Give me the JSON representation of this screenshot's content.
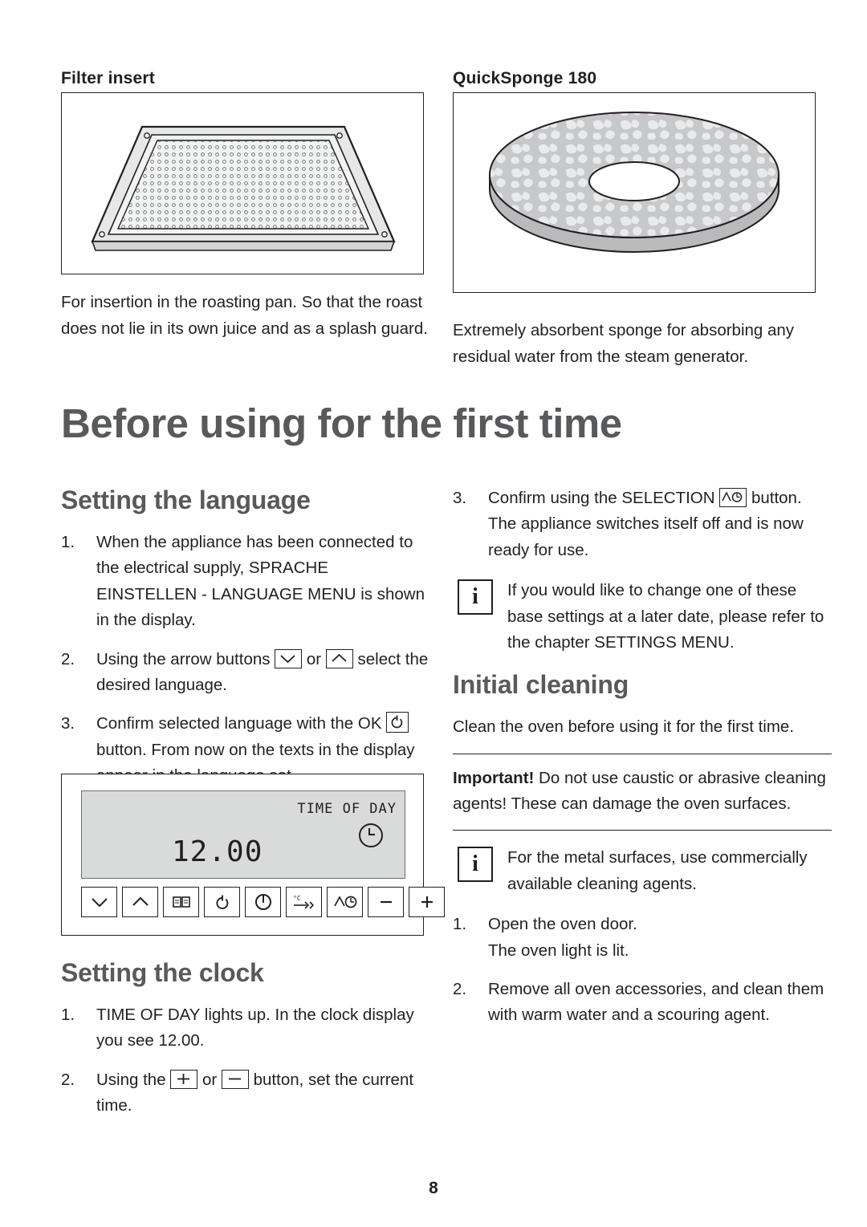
{
  "page": {
    "number": "8"
  },
  "top": {
    "left_heading": "Filter insert",
    "right_heading": "QuickSponge 180",
    "left_caption": "For insertion in the roasting pan. So that the roast does not lie in its own juice and as a splash guard.",
    "right_caption": "Extremely absorbent sponge for absorbing any residual water from the steam generator.",
    "left_figure_name": "filter-insert-illustration",
    "right_figure_name": "quicksponge-illustration"
  },
  "chapter": {
    "title": "Before using for the first time"
  },
  "language": {
    "heading": "Setting the language",
    "steps": [
      {
        "num": "1.",
        "text_a": "When the appliance has been connected to the electrical supply, SPRACHE EINSTELLEN - LANGUAGE MENU is shown in the display."
      },
      {
        "num": "2.",
        "text_a": "Using the arrow buttons ",
        "text_b": " or ",
        "text_c": " select the desired language."
      },
      {
        "num": "3.",
        "text_a": "Confirm selected language with the OK ",
        "text_b": " button. From now on the texts in the display appear in the language set."
      }
    ]
  },
  "display_figure": {
    "label_time_of_day": "TIME OF DAY",
    "time_value": "12.00",
    "buttons": [
      "arrow-down-button",
      "arrow-up-button",
      "book-menu-button",
      "ok-button",
      "on-off-button",
      "fast-heat-button",
      "selection-button",
      "minus-button",
      "plus-button"
    ]
  },
  "clock": {
    "heading": "Setting the clock",
    "steps": [
      {
        "num": "1.",
        "text_a": "TIME OF DAY lights up. In the clock display you see 12.00."
      },
      {
        "num": "2.",
        "text_a": "Using the ",
        "text_b": " or ",
        "text_c": " button, set the current time."
      }
    ]
  },
  "right_column": {
    "step3": {
      "num": "3.",
      "text_a": "Confirm using the SELECTION ",
      "text_b": " button. The appliance switches itself off and is now ready for use."
    },
    "note1": "If you would like to change one of these base settings at a later date, please refer to the chapter SETTINGS MENU.",
    "note_icon_letter": "i",
    "cleaning_heading": "Initial cleaning",
    "cleaning_intro": "Clean the oven before using it for the first time.",
    "important_label": "Important!",
    "important_text": " Do not use caustic or abrasive cleaning agents! These can damage the oven surfaces.",
    "note2": "For the metal surfaces, use commercially available cleaning agents.",
    "steps": [
      {
        "num": "1.",
        "text_a": "Open the oven door.",
        "text_b": "The oven light is lit."
      },
      {
        "num": "2.",
        "text_a": "Remove all oven accessories, and clean them with warm water and a scouring agent."
      }
    ]
  }
}
